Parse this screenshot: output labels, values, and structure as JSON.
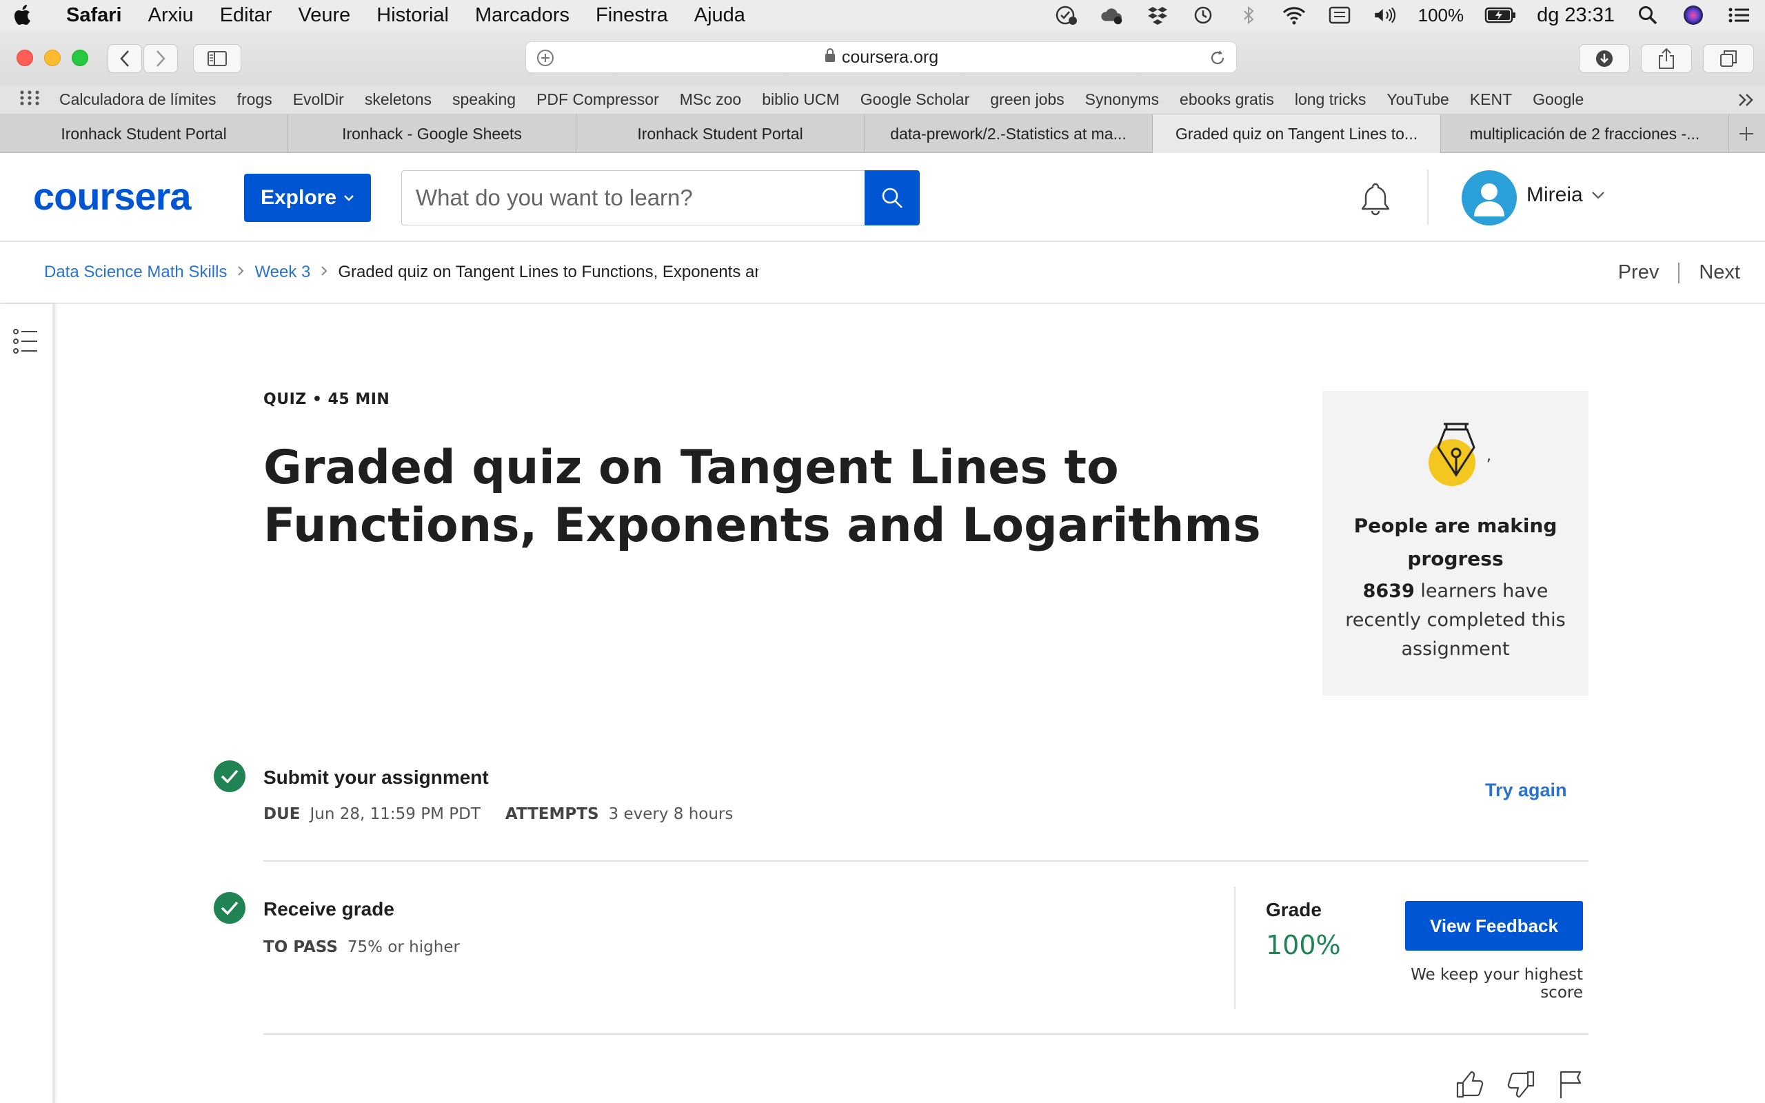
{
  "menubar": {
    "app": "Safari",
    "items": [
      "Arxiu",
      "Editar",
      "Veure",
      "Historial",
      "Marcadors",
      "Finestra",
      "Ajuda"
    ],
    "battery": "100%",
    "clock": "dg 23:31"
  },
  "toolbar": {
    "url": "coursera.org"
  },
  "bookmarks": [
    "Calculadora de límites",
    "frogs",
    "EvolDir",
    "skeletons",
    "speaking",
    "PDF Compressor",
    "MSc zoo",
    "biblio UCM",
    "Google Scholar",
    "green jobs",
    "Synonyms",
    "ebooks gratis",
    "long tricks",
    "YouTube",
    "KENT",
    "Google"
  ],
  "tabs": [
    {
      "label": "Ironhack Student Portal",
      "active": false
    },
    {
      "label": "Ironhack - Google Sheets",
      "active": false
    },
    {
      "label": "Ironhack Student Portal",
      "active": false
    },
    {
      "label": "data-prework/2.-Statistics at ma...",
      "active": false
    },
    {
      "label": "Graded quiz on Tangent Lines to...",
      "active": true
    },
    {
      "label": "multiplicación de 2 fracciones -...",
      "active": false
    }
  ],
  "header": {
    "logo": "coursera",
    "explore": "Explore",
    "search_placeholder": "What do you want to learn?",
    "username": "Mireia"
  },
  "breadcrumb": {
    "course": "Data Science Math Skills",
    "week": "Week 3",
    "current": "Graded quiz on Tangent Lines to Functions, Exponents and Logarithms",
    "prev": "Prev",
    "next": "Next"
  },
  "quiz": {
    "kicker": "QUIZ • 45 MIN",
    "title": "Graded quiz on Tangent Lines to Functions, Exponents and Logarithms"
  },
  "progress_card": {
    "comma": ",",
    "title": "People are making progress",
    "count": "8639",
    "body": "learners have recently completed this assignment"
  },
  "submit": {
    "title": "Submit your assignment",
    "due_label": "DUE",
    "due_value": "Jun 28, 11:59 PM PDT",
    "attempts_label": "ATTEMPTS",
    "attempts_value": "3 every 8 hours",
    "try_again": "Try again"
  },
  "grade": {
    "title": "Receive grade",
    "pass_label": "TO PASS",
    "pass_value": "75% or higher",
    "grade_label": "Grade",
    "grade_value": "100%",
    "view_feedback": "View Feedback",
    "note": "We keep your highest score"
  },
  "colors": {
    "brand": "#0056d2",
    "success": "#1f8354",
    "link": "#2a73cc"
  }
}
